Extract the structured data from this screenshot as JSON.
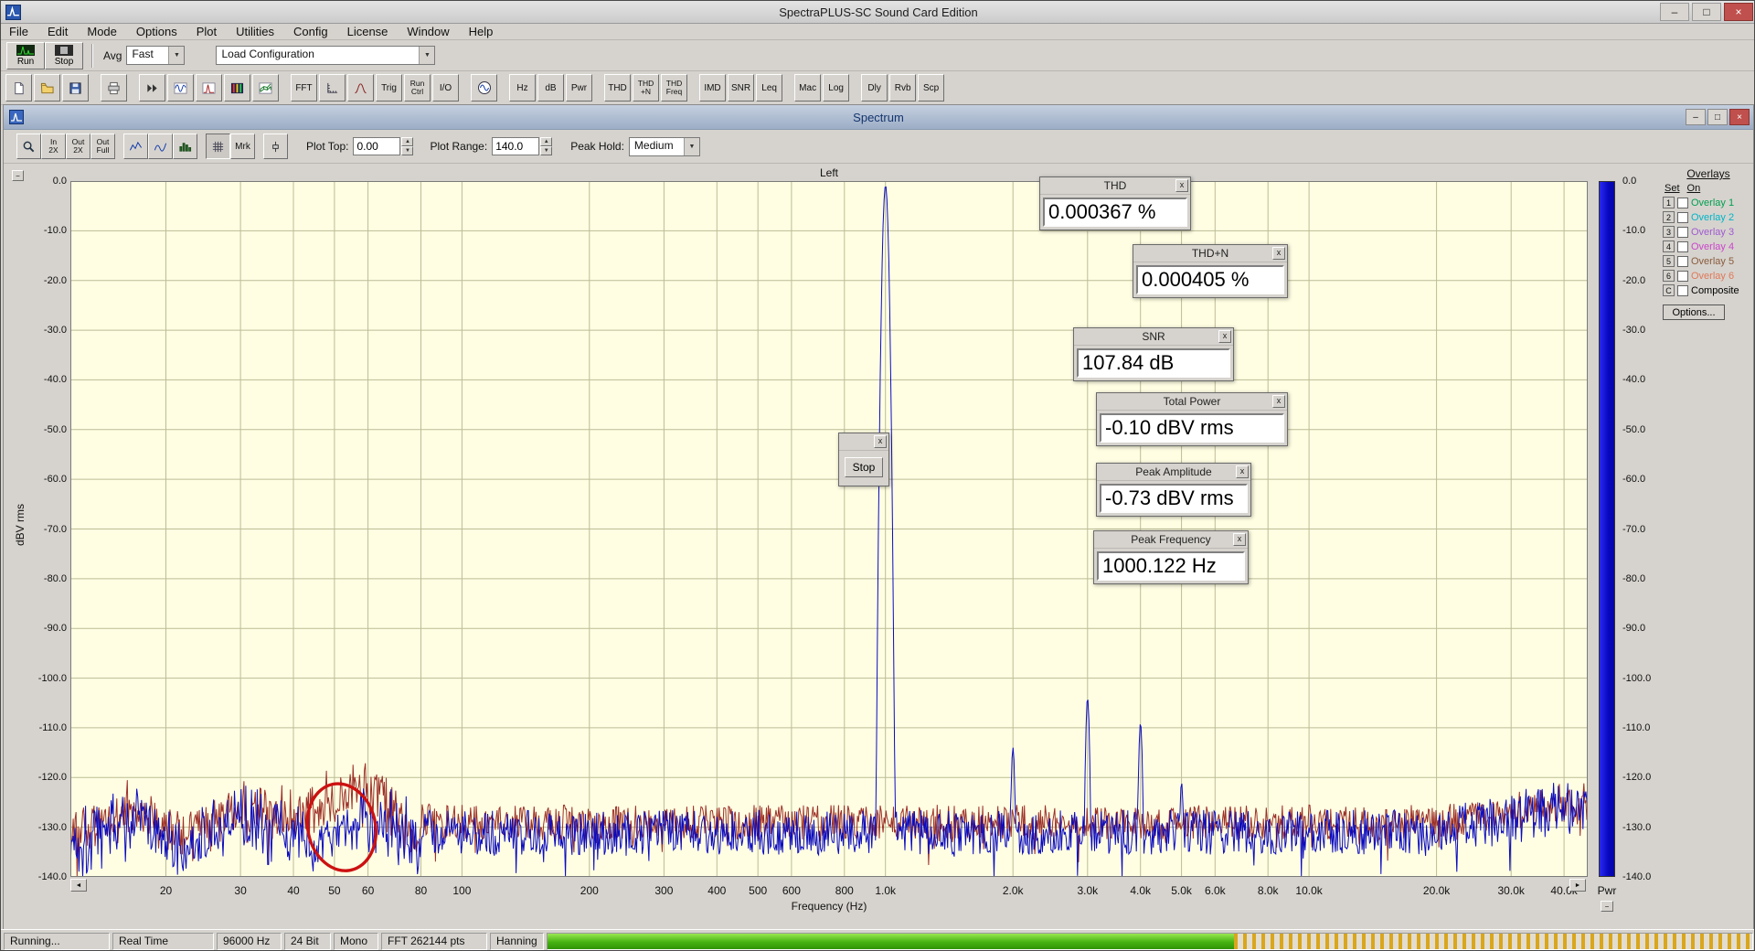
{
  "app": {
    "title": "SpectraPLUS-SC Sound Card Edition"
  },
  "glyphs": {
    "min": "–",
    "max": "□",
    "close": "×",
    "combo_arrow": "▼",
    "spin_up": "▲",
    "spin_down": "▼",
    "left_arrow": "◄",
    "right_arrow": "►",
    "collapse": "−",
    "panel_close": "x"
  },
  "menu": {
    "items": [
      "File",
      "Edit",
      "Mode",
      "Options",
      "Plot",
      "Utilities",
      "Config",
      "License",
      "Window",
      "Help"
    ]
  },
  "toolbar1": {
    "run_label": "Run",
    "stop_label": "Stop",
    "avg_label": "Avg",
    "avg_value": "Fast",
    "load_config": "Load Configuration"
  },
  "toolbar2": {
    "items": [
      {
        "t": "icon",
        "n": "new-file-icon"
      },
      {
        "t": "icon",
        "n": "open-file-icon"
      },
      {
        "t": "icon",
        "n": "save-icon"
      },
      {
        "t": "gap"
      },
      {
        "t": "icon",
        "n": "print-icon"
      },
      {
        "t": "gap"
      },
      {
        "t": "icon",
        "n": "fast-forward-icon"
      },
      {
        "t": "icon",
        "n": "time-series-icon"
      },
      {
        "t": "icon",
        "n": "spectrum-plot-icon"
      },
      {
        "t": "icon",
        "n": "spectrogram-icon"
      },
      {
        "t": "icon",
        "n": "surface-plot-icon"
      },
      {
        "t": "gap"
      },
      {
        "t": "text",
        "l": "FFT",
        "n": "fft-settings-button"
      },
      {
        "t": "icon",
        "n": "scaling-icon"
      },
      {
        "t": "icon",
        "n": "smoothing-window-icon"
      },
      {
        "t": "text",
        "l": "Trig",
        "n": "trigger-button"
      },
      {
        "t": "text2",
        "l": [
          "Run",
          "Ctrl"
        ],
        "n": "run-control-button"
      },
      {
        "t": "text",
        "l": "I/O",
        "n": "io-button"
      },
      {
        "t": "gap"
      },
      {
        "t": "icon",
        "n": "signal-generator-icon"
      },
      {
        "t": "gap"
      },
      {
        "t": "text",
        "l": "Hz",
        "n": "hz-units-button"
      },
      {
        "t": "text",
        "l": "dB",
        "n": "db-units-button"
      },
      {
        "t": "text",
        "l": "Pwr",
        "n": "power-units-button"
      },
      {
        "t": "gap"
      },
      {
        "t": "text",
        "l": "THD",
        "n": "thd-button"
      },
      {
        "t": "text2",
        "l": [
          "THD",
          "+N"
        ],
        "n": "thd-n-button"
      },
      {
        "t": "text2",
        "l": [
          "THD",
          "Freq"
        ],
        "n": "thd-freq-button"
      },
      {
        "t": "gap"
      },
      {
        "t": "text",
        "l": "IMD",
        "n": "imd-button"
      },
      {
        "t": "text",
        "l": "SNR",
        "n": "snr-button"
      },
      {
        "t": "text",
        "l": "Leq",
        "n": "leq-button"
      },
      {
        "t": "gap"
      },
      {
        "t": "text",
        "l": "Mac",
        "n": "macro-button"
      },
      {
        "t": "text",
        "l": "Log",
        "n": "logging-button"
      },
      {
        "t": "gap"
      },
      {
        "t": "text",
        "l": "Dly",
        "n": "delay-button"
      },
      {
        "t": "text",
        "l": "Rvb",
        "n": "reverb-button"
      },
      {
        "t": "text",
        "l": "Scp",
        "n": "scope-button"
      }
    ]
  },
  "spectrum_window": {
    "title": "Spectrum",
    "toolbar": {
      "zoom_in_l1": "In",
      "zoom_in_l2": "2X",
      "zoom_out_l1": "Out",
      "zoom_out_l2": "2X",
      "zoom_full_l1": "Out",
      "zoom_full_l2": "Full",
      "mrk": "Mrk",
      "plot_top_label": "Plot Top:",
      "plot_top": "0.00",
      "plot_range_label": "Plot Range:",
      "plot_range": "140.0",
      "peak_hold_label": "Peak Hold:",
      "peak_hold": "Medium"
    }
  },
  "chart_data": {
    "type": "line",
    "channel": "Left",
    "xlabel": "Frequency (Hz)",
    "ylabel": "dBV rms",
    "x_scale": "log",
    "x_range_hz": [
      11.9,
      45500
    ],
    "ylim_db": [
      -140,
      0
    ],
    "y_tick_step_db": 10,
    "grid": true,
    "plot_bg": "#fffee3",
    "grid_color": "#bcbc96",
    "x_ticks": [
      {
        "f": 20,
        "label": "20"
      },
      {
        "f": 30,
        "label": "30"
      },
      {
        "f": 40,
        "label": "40"
      },
      {
        "f": 50,
        "label": "50"
      },
      {
        "f": 60,
        "label": "60"
      },
      {
        "f": 80,
        "label": "80"
      },
      {
        "f": 100,
        "label": "100"
      },
      {
        "f": 200,
        "label": "200"
      },
      {
        "f": 300,
        "label": "300"
      },
      {
        "f": 400,
        "label": "400"
      },
      {
        "f": 500,
        "label": "500"
      },
      {
        "f": 600,
        "label": "600"
      },
      {
        "f": 800,
        "label": "800"
      },
      {
        "f": 1000,
        "label": "1.0k"
      },
      {
        "f": 2000,
        "label": "2.0k"
      },
      {
        "f": 3000,
        "label": "3.0k"
      },
      {
        "f": 4000,
        "label": "4.0k"
      },
      {
        "f": 5000,
        "label": "5.0k"
      },
      {
        "f": 6000,
        "label": "6.0k"
      },
      {
        "f": 8000,
        "label": "8.0k"
      },
      {
        "f": 10000,
        "label": "10.0k"
      },
      {
        "f": 20000,
        "label": "20.0k"
      },
      {
        "f": 30000,
        "label": "30.0k"
      },
      {
        "f": 40000,
        "label": "40.0k"
      }
    ],
    "series": [
      {
        "name": "live",
        "color": "#0b0bc0",
        "noise_floor_db": -131,
        "noise_jitter_db": 4.5,
        "lf_extra_jitter_db": 4,
        "hf_rise_db": 8,
        "peaks": [
          {
            "f": 1000.122,
            "db": -0.9,
            "w": 0.002
          },
          {
            "f": 2000,
            "db": -114,
            "w": 0.0015
          },
          {
            "f": 3000,
            "db": -104,
            "w": 0.0015
          },
          {
            "f": 4000,
            "db": -109,
            "w": 0.0015
          },
          {
            "f": 5000,
            "db": -121,
            "w": 0.0015
          },
          {
            "f": 6000,
            "db": -127,
            "w": 0.0014
          }
        ]
      },
      {
        "name": "overlay",
        "color": "#9c3028",
        "noise_floor_db": -129,
        "noise_jitter_db": 3.5,
        "lf_extra_jitter_db": 3,
        "hf_rise_db": 6,
        "bump": {
          "f": 50,
          "db_gain": 6,
          "w": 0.12
        },
        "peaks": []
      }
    ],
    "annotation": {
      "type": "ellipse",
      "f_center": 52,
      "db_center": -130,
      "color": "#cc1111"
    }
  },
  "meter": {
    "label": "Pwr"
  },
  "overlays": {
    "title": "Overlays",
    "col_set": "Set",
    "col_on": "On",
    "rows": [
      {
        "num": "1",
        "label": "Overlay 1",
        "color": "#00a050"
      },
      {
        "num": "2",
        "label": "Overlay 2",
        "color": "#00b5c8"
      },
      {
        "num": "3",
        "label": "Overlay 3",
        "color": "#a05ad0"
      },
      {
        "num": "4",
        "label": "Overlay 4",
        "color": "#cc44cc"
      },
      {
        "num": "5",
        "label": "Overlay 5",
        "color": "#8a5c3c"
      },
      {
        "num": "6",
        "label": "Overlay 6",
        "color": "#e07858"
      },
      {
        "num": "C",
        "label": "Composite",
        "color": "#000000"
      }
    ],
    "options_label": "Options..."
  },
  "panels": {
    "thd": {
      "title": "THD",
      "value": "0.000367 %"
    },
    "thdn": {
      "title": "THD+N",
      "value": "0.000405 %"
    },
    "snr": {
      "title": "SNR",
      "value": "107.84 dB"
    },
    "total_power": {
      "title": "Total Power",
      "value": "-0.10 dBV rms"
    },
    "peak_amplitude": {
      "title": "Peak Amplitude",
      "value": "-0.73 dBV rms"
    },
    "peak_frequency": {
      "title": "Peak Frequency",
      "value": "1000.122 Hz"
    },
    "stop": {
      "label": "Stop"
    }
  },
  "status": {
    "cells": [
      "Running...",
      "Real Time",
      "96000 Hz",
      "24 Bit",
      "Mono",
      "FFT 262144 pts",
      "Hanning"
    ],
    "meter_green_fraction": 0.57
  }
}
